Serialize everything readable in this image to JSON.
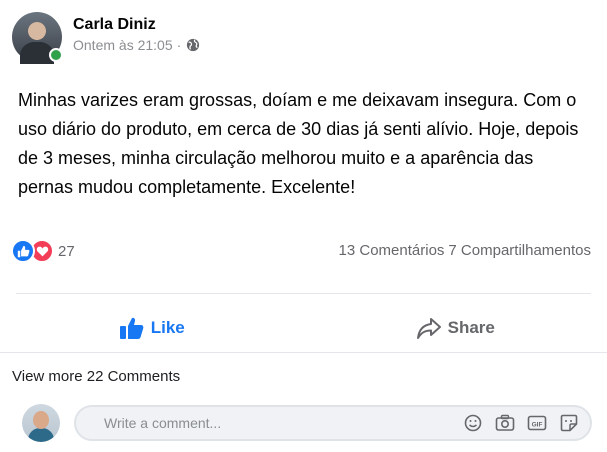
{
  "post": {
    "author": "Carla Diniz",
    "timestamp": "Ontem às 21:05",
    "separator": "·",
    "privacy_icon": "globe-icon",
    "online": true,
    "text": "Minhas varizes eram grossas, doíam e me deixavam insegura. Com o uso diário do produto, em cerca de 30 dias já senti alívio. Hoje, depois de 3 meses, minha circulação melhorou muito e a aparência das pernas mudou completamente. Excelente!"
  },
  "reactions": {
    "types": [
      "like",
      "love"
    ],
    "count": "27",
    "comments": "13 Comentários",
    "shares": "7 Compartilhamentos"
  },
  "actions": {
    "like_label": "Like",
    "share_label": "Share"
  },
  "comments": {
    "view_more": "View more 22 Comments",
    "placeholder": "Write a comment...",
    "tools": [
      "emoji-icon",
      "camera-icon",
      "gif-icon",
      "sticker-icon"
    ]
  },
  "colors": {
    "brand_blue": "#1877f2",
    "love_red": "#f33e58",
    "online_green": "#31a24c",
    "muted_text": "#65676b"
  }
}
